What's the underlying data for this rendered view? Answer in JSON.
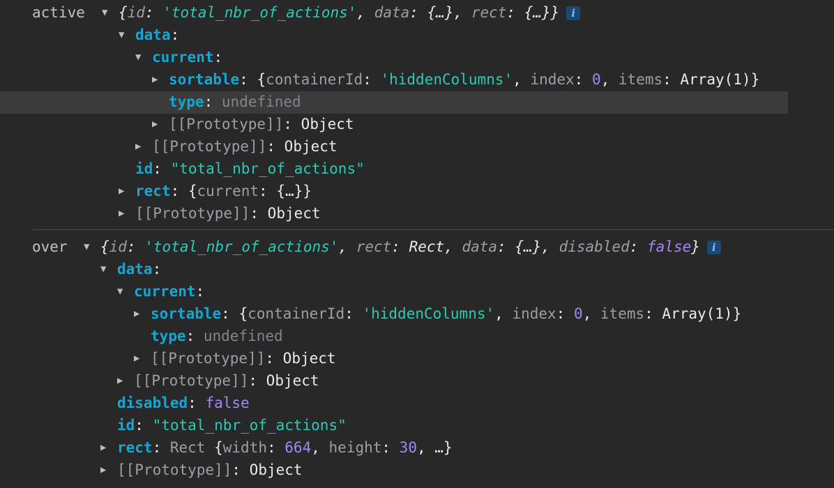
{
  "active": {
    "label": "active",
    "summary": {
      "open": "{",
      "k1": "id",
      "v1": "'total_nbr_of_actions'",
      "k2": "data",
      "v2": "{…}",
      "k3": "rect",
      "v3": "{…}",
      "close": "}"
    },
    "info_icon": "i",
    "data_key": "data",
    "current_key": "current",
    "sortable": {
      "key": "sortable",
      "open": "{",
      "k1": "containerId",
      "v1": "'hiddenColumns'",
      "k2": "index",
      "v2": "0",
      "k3": "items",
      "v3": "Array(1)",
      "close": "}"
    },
    "type": {
      "key": "type",
      "value": "undefined"
    },
    "proto_inner": {
      "key": "[[Prototype]]",
      "value": "Object"
    },
    "proto_data": {
      "key": "[[Prototype]]",
      "value": "Object"
    },
    "id": {
      "key": "id",
      "value": "\"total_nbr_of_actions\""
    },
    "rect": {
      "key": "rect",
      "open": "{",
      "k1": "current",
      "v1": "{…}",
      "close": "}"
    },
    "proto_root": {
      "key": "[[Prototype]]",
      "value": "Object"
    }
  },
  "over": {
    "label": "over",
    "summary": {
      "open": "{",
      "k1": "id",
      "v1": "'total_nbr_of_actions'",
      "k2": "rect",
      "v2": "Rect",
      "k3": "data",
      "v3": "{…}",
      "k4": "disabled",
      "v4": "false",
      "close": "}"
    },
    "info_icon": "i",
    "data_key": "data",
    "current_key": "current",
    "sortable": {
      "key": "sortable",
      "open": "{",
      "k1": "containerId",
      "v1": "'hiddenColumns'",
      "k2": "index",
      "v2": "0",
      "k3": "items",
      "v3": "Array(1)",
      "close": "}"
    },
    "type": {
      "key": "type",
      "value": "undefined"
    },
    "proto_inner": {
      "key": "[[Prototype]]",
      "value": "Object"
    },
    "proto_data": {
      "key": "[[Prototype]]",
      "value": "Object"
    },
    "disabled": {
      "key": "disabled",
      "value": "false"
    },
    "id": {
      "key": "id",
      "value": "\"total_nbr_of_actions\""
    },
    "rect": {
      "key": "rect",
      "class_name": "Rect",
      "open": "{",
      "k1": "width",
      "v1": "664",
      "k2": "height",
      "v2": "30",
      "more": "…",
      "close": "}"
    },
    "proto_root": {
      "key": "[[Prototype]]",
      "value": "Object"
    }
  },
  "icons": {
    "expanded": "▼",
    "collapsed": "▶"
  }
}
